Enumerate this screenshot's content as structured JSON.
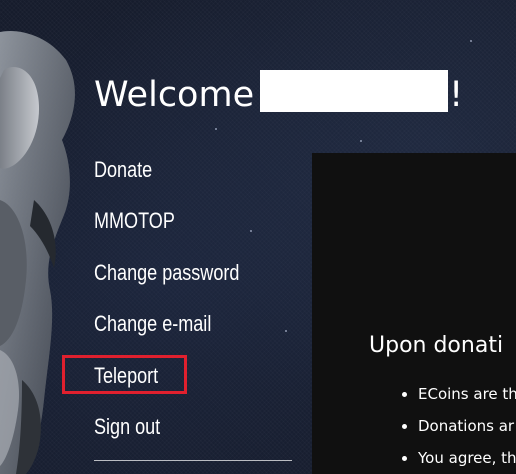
{
  "welcome": {
    "greeting": "Welcome",
    "suffix": "!"
  },
  "nav": {
    "items": [
      {
        "label": "Donate"
      },
      {
        "label": "MMOTOP"
      },
      {
        "label": "Change password"
      },
      {
        "label": "Change e-mail"
      },
      {
        "label": "Teleport"
      },
      {
        "label": "Sign out"
      }
    ],
    "highlighted_item": "Teleport",
    "highlight_color": "#e0202e"
  },
  "content": {
    "heading": "Upon donati",
    "bullets": [
      "ECoins are th",
      "Donations ar",
      "You agree, th"
    ]
  },
  "colors": {
    "background": "#161c2c",
    "panel": "#101010",
    "text": "#ffffff"
  }
}
